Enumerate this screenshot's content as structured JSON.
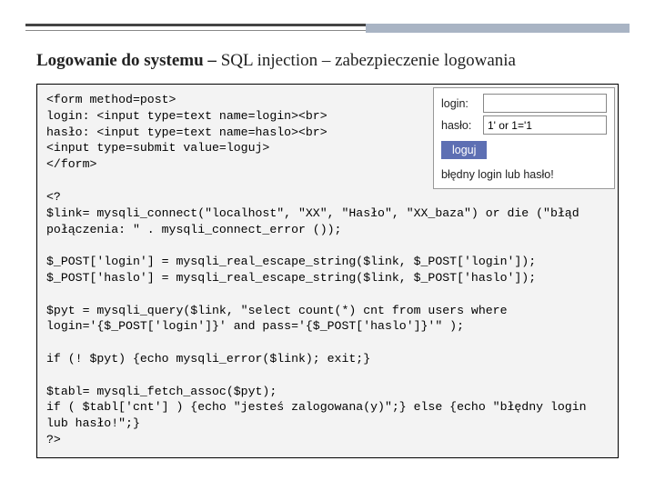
{
  "heading": {
    "bold": "Logowanie do systemu – ",
    "rest": "SQL injection – zabezpieczenie logowania"
  },
  "code": "<form method=post>\nlogin: <input type=text name=login><br>\nhasło: <input type=text name=haslo><br>\n<input type=submit value=loguj>\n</form>\n\n<?\n$link= mysqli_connect(\"localhost\", \"XX\", \"Hasło\", \"XX_baza\") or die (\"błąd połączenia: \" . mysqli_connect_error ());\n\n$_POST['login'] = mysqli_real_escape_string($link, $_POST['login']);\n$_POST['haslo'] = mysqli_real_escape_string($link, $_POST['haslo']);\n\n$pyt = mysqli_query($link, \"select count(*) cnt from users where login='{$_POST['login']}' and pass='{$_POST['haslo']}'\" );\n\nif (! $pyt) {echo mysqli_error($link); exit;}\n\n$tabl= mysqli_fetch_assoc($pyt);\nif ( $tabl['cnt'] ) {echo \"jesteś zalogowana(y)\";} else {echo \"błędny login lub hasło!\";}\n?>",
  "form": {
    "login_label": "login:",
    "login_value": "",
    "haslo_label": "hasło:",
    "haslo_value": "1' or 1='1",
    "submit_label": "loguj",
    "error": "błędny login lub hasło!"
  }
}
